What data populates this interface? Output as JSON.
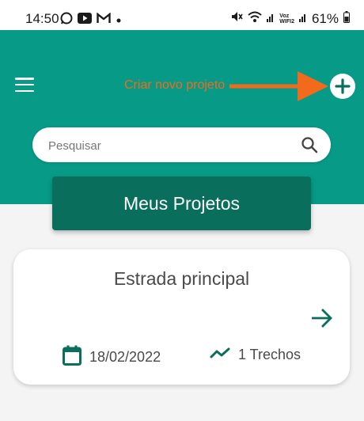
{
  "status_bar": {
    "time": "14:50",
    "battery": "61%",
    "network_label_top": "Voz",
    "network_label_bottom": "WIFI2",
    "left_icons": [
      "whatsapp-icon",
      "youtube-icon",
      "gmail-icon",
      "dot-icon"
    ],
    "right_icons": [
      "mute-icon",
      "wifi-icon",
      "signal-icon",
      "signal-icon",
      "battery-icon"
    ]
  },
  "header": {
    "menu_icon": "menu-icon",
    "add_icon": "plus-icon",
    "annotation": "Criar novo projeto",
    "background_color": "#079a86"
  },
  "search": {
    "placeholder": "Pesquisar",
    "value": ""
  },
  "section": {
    "title": "Meus Projetos",
    "background_color": "#0a6e5c"
  },
  "projects": [
    {
      "name": "Estrada principal",
      "date": "18/02/2022",
      "segments": "1 Trechos"
    }
  ],
  "colors": {
    "accent": "#0a6e5c",
    "annotation": "#f26a1b"
  }
}
